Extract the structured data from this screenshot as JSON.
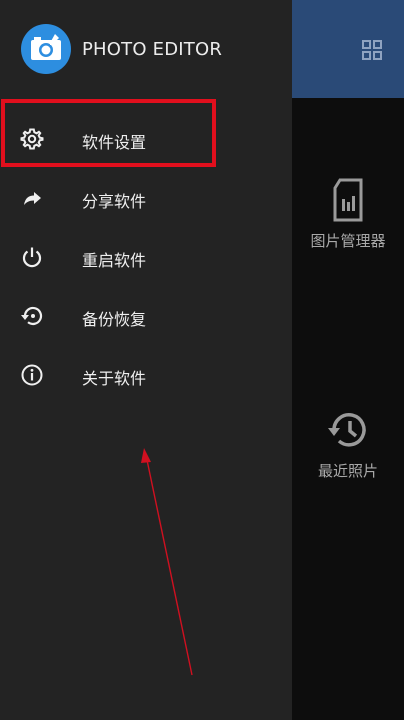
{
  "app": {
    "title": "PHOTO EDITOR"
  },
  "drawer": {
    "items": [
      {
        "label": "软件设置",
        "icon": "gear-icon"
      },
      {
        "label": "分享软件",
        "icon": "share-icon"
      },
      {
        "label": "重启软件",
        "icon": "power-icon"
      },
      {
        "label": "备份恢复",
        "icon": "restore-icon"
      },
      {
        "label": "关于软件",
        "icon": "info-icon"
      }
    ]
  },
  "background": {
    "tiles": [
      {
        "label": "图片管理器",
        "icon": "sd-card-icon"
      },
      {
        "label": "最近照片",
        "icon": "history-icon"
      }
    ]
  },
  "colors": {
    "drawer_bg": "#232323",
    "header_blue": "#2a4a77",
    "logo_blue": "#2d8ee0",
    "highlight_red": "#e10f1d"
  }
}
